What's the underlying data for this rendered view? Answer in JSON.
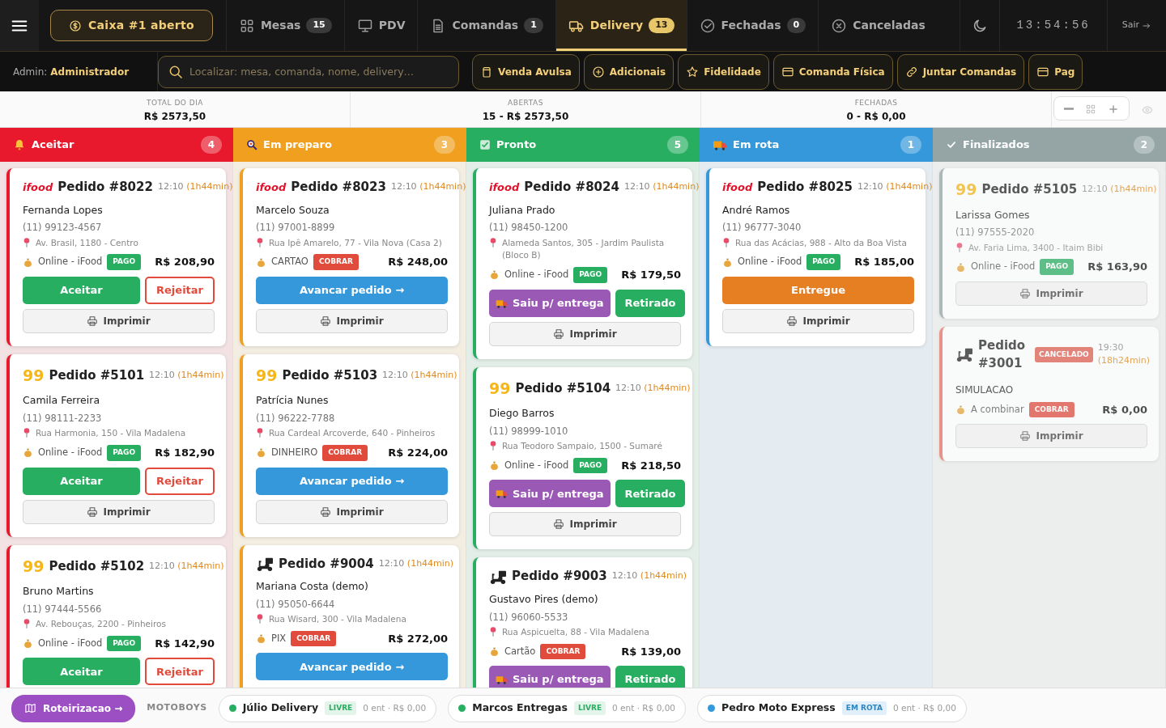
{
  "topbar": {
    "cash_button": "Caixa #1 aberto",
    "tabs": [
      {
        "label": "Mesas",
        "count": "15",
        "kind": "tables",
        "selected": false
      },
      {
        "label": "PDV",
        "kind": "pos",
        "selected": false
      },
      {
        "label": "Comandas",
        "count": "1",
        "kind": "orders",
        "selected": false
      },
      {
        "label": "Delivery",
        "count": "13",
        "kind": "delivery",
        "selected": true
      },
      {
        "label": "Fechadas",
        "count": "0",
        "kind": "closed",
        "selected": false
      },
      {
        "label": "Canceladas",
        "kind": "cancelled",
        "selected": false
      }
    ],
    "clock": "13:54:56",
    "logout": "Sair"
  },
  "subbar": {
    "user_label": "Admin:",
    "user_name": "Administrador",
    "search": {
      "placeholder": "Localizar: mesa, comanda, nome, delivery…"
    },
    "actions": [
      {
        "label": "Venda Avulsa",
        "kind": "sale"
      },
      {
        "label": "Adicionais",
        "kind": "extras"
      },
      {
        "label": "Fidelidade",
        "kind": "loyalty"
      },
      {
        "label": "Comanda Física",
        "kind": "ticket"
      },
      {
        "label": "Juntar Comandas",
        "kind": "merge"
      },
      {
        "label": "Pag",
        "kind": "payment"
      }
    ]
  },
  "stats": [
    {
      "label": "TOTAL DO DIA",
      "value": "R$ 2573,50"
    },
    {
      "label": "ABERTAS",
      "value": "15 - R$ 2573,50"
    },
    {
      "label": "FECHADAS",
      "value": "0 - R$ 0,00"
    }
  ],
  "columns": [
    {
      "title": "Aceitar",
      "count": "4",
      "color": "#e8192c",
      "kind": "incoming",
      "dimmed": false,
      "cards": [
        {
          "source": {
            "kind": "ifood",
            "label": "ifood"
          },
          "title": "Pedido #8022",
          "time": "12:10",
          "elapsed": "(1h44min)",
          "customer": "Fernanda Lopes",
          "phone": "(11) 99123-4567",
          "address": "Av. Brasil, 1180 - Centro",
          "payment": "Online - iFood",
          "payment_tag": {
            "label": "PAGO",
            "kind": "paid"
          },
          "total": "R$ 208,90",
          "actions": [
            {
              "label": "Aceitar",
              "kind": "accept"
            },
            {
              "label": "Rejeitar",
              "kind": "reject"
            },
            {
              "label": "Imprimir",
              "kind": "print"
            }
          ]
        },
        {
          "source": {
            "kind": "ninetynine",
            "label": "99"
          },
          "title": "Pedido #5101",
          "time": "12:10",
          "elapsed": "(1h44min)",
          "customer": "Camila Ferreira",
          "phone": "(11) 98111-2233",
          "address": "Rua Harmonia, 150 - Vila Madalena",
          "payment": "Online - iFood",
          "payment_tag": {
            "label": "PAGO",
            "kind": "paid"
          },
          "total": "R$ 182,90",
          "actions": [
            {
              "label": "Aceitar",
              "kind": "accept"
            },
            {
              "label": "Rejeitar",
              "kind": "reject"
            },
            {
              "label": "Imprimir",
              "kind": "print"
            }
          ]
        },
        {
          "source": {
            "kind": "ninetynine",
            "label": "99"
          },
          "title": "Pedido #5102",
          "time": "12:10",
          "elapsed": "(1h44min)",
          "customer": "Bruno Martins",
          "phone": "(11) 97444-5566",
          "address": "Av. Rebouças, 2200 - Pinheiros",
          "payment": "Online - iFood",
          "payment_tag": {
            "label": "PAGO",
            "kind": "paid"
          },
          "total": "R$ 142,90",
          "actions": [
            {
              "label": "Aceitar",
              "kind": "accept"
            },
            {
              "label": "Rejeitar",
              "kind": "reject"
            }
          ]
        }
      ]
    },
    {
      "title": "Em preparo",
      "count": "3",
      "color": "#f0a01e",
      "kind": "preparing",
      "dimmed": false,
      "cards": [
        {
          "source": {
            "kind": "ifood",
            "label": "ifood"
          },
          "title": "Pedido #8023",
          "time": "12:10",
          "elapsed": "(1h44min)",
          "customer": "Marcelo Souza",
          "phone": "(11) 97001-8899",
          "address": "Rua Ipê Amarelo, 77 - Vila Nova (Casa 2)",
          "payment": "CARTAO",
          "payment_tag": {
            "label": "COBRAR",
            "kind": "due"
          },
          "total": "R$ 248,00",
          "actions": [
            {
              "label": "Avancar pedido →",
              "kind": "advance"
            },
            {
              "label": "Imprimir",
              "kind": "print"
            }
          ]
        },
        {
          "source": {
            "kind": "ninetynine",
            "label": "99"
          },
          "title": "Pedido #5103",
          "time": "12:10",
          "elapsed": "(1h44min)",
          "customer": "Patrícia Nunes",
          "phone": "(11) 96222-7788",
          "address": "Rua Cardeal Arcoverde, 640 - Pinheiros",
          "payment": "DINHEIRO",
          "payment_tag": {
            "label": "COBRAR",
            "kind": "due"
          },
          "total": "R$ 224,00",
          "actions": [
            {
              "label": "Avancar pedido →",
              "kind": "advance"
            },
            {
              "label": "Imprimir",
              "kind": "print"
            }
          ]
        },
        {
          "source": {
            "kind": "moto"
          },
          "title": "Pedido #9004",
          "time": "12:10",
          "elapsed": "(1h44min)",
          "customer": "Mariana Costa (demo)",
          "phone": "(11) 95050-6644",
          "address": "Rua Wisard, 300 - Vila Madalena",
          "payment": "PIX",
          "payment_tag": {
            "label": "COBRAR",
            "kind": "due"
          },
          "total": "R$ 272,00",
          "actions": [
            {
              "label": "Avancar pedido →",
              "kind": "advance"
            }
          ]
        }
      ]
    },
    {
      "title": "Pronto",
      "count": "5",
      "color": "#27ae60",
      "kind": "ready",
      "dimmed": false,
      "cards": [
        {
          "source": {
            "kind": "ifood",
            "label": "ifood"
          },
          "title": "Pedido #8024",
          "time": "12:10",
          "elapsed": "(1h44min)",
          "customer": "Juliana Prado",
          "phone": "(11) 98450-1200",
          "address": "Alameda Santos, 305 - Jardim Paulista (Bloco B)",
          "payment": "Online - iFood",
          "payment_tag": {
            "label": "PAGO",
            "kind": "paid"
          },
          "total": "R$ 179,50",
          "actions": [
            {
              "label": "Saiu p/ entrega",
              "kind": "dispatch"
            },
            {
              "label": "Retirado",
              "kind": "pickup"
            },
            {
              "label": "Imprimir",
              "kind": "print"
            }
          ]
        },
        {
          "source": {
            "kind": "ninetynine",
            "label": "99"
          },
          "title": "Pedido #5104",
          "time": "12:10",
          "elapsed": "(1h44min)",
          "customer": "Diego Barros",
          "phone": "(11) 98999-1010",
          "address": "Rua Teodoro Sampaio, 1500 - Sumaré",
          "payment": "Online - iFood",
          "payment_tag": {
            "label": "PAGO",
            "kind": "paid"
          },
          "total": "R$ 218,50",
          "actions": [
            {
              "label": "Saiu p/ entrega",
              "kind": "dispatch"
            },
            {
              "label": "Retirado",
              "kind": "pickup"
            },
            {
              "label": "Imprimir",
              "kind": "print"
            }
          ]
        },
        {
          "source": {
            "kind": "moto"
          },
          "title": "Pedido #9003",
          "time": "12:10",
          "elapsed": "(1h44min)",
          "customer": "Gustavo Pires (demo)",
          "phone": "(11) 96060-5533",
          "address": "Rua Aspicuelta, 88 - Vila Madalena",
          "payment": "Cartão",
          "payment_tag": {
            "label": "COBRAR",
            "kind": "due"
          },
          "total": "R$ 139,00",
          "actions": [
            {
              "label": "Saiu p/ entrega",
              "kind": "dispatch"
            },
            {
              "label": "Retirado",
              "kind": "pickup"
            }
          ]
        }
      ]
    },
    {
      "title": "Em rota",
      "count": "1",
      "color": "#3498db",
      "kind": "route",
      "dimmed": false,
      "cards": [
        {
          "source": {
            "kind": "ifood",
            "label": "ifood"
          },
          "title": "Pedido #8025",
          "time": "12:10",
          "elapsed": "(1h44min)",
          "customer": "André Ramos",
          "phone": "(11) 96777-3040",
          "address": "Rua das Acácias, 988 - Alto da Boa Vista",
          "payment": "Online - iFood",
          "payment_tag": {
            "label": "PAGO",
            "kind": "paid"
          },
          "total": "R$ 185,00",
          "actions": [
            {
              "label": "Entregue",
              "kind": "deliver"
            },
            {
              "label": "Imprimir",
              "kind": "print"
            }
          ]
        }
      ]
    },
    {
      "title": "Finalizados",
      "count": "2",
      "color": "#95a5a6",
      "kind": "done",
      "dimmed": true,
      "cards": [
        {
          "source": {
            "kind": "ninetynine",
            "label": "99"
          },
          "title": "Pedido #5105",
          "time": "12:10",
          "elapsed": "(1h44min)",
          "customer": "Larissa Gomes",
          "phone": "(11) 97555-2020",
          "address": "Av. Faria Lima, 3400 - Itaim Bibi",
          "payment": "Online - iFood",
          "payment_tag": {
            "label": "PAGO",
            "kind": "paid"
          },
          "total": "R$ 163,90",
          "actions": [
            {
              "label": "Imprimir",
              "kind": "print"
            }
          ]
        },
        {
          "source": {
            "kind": "moto"
          },
          "title": "Pedido #3001",
          "status_tag": "CANCELADO",
          "time": "19:30",
          "elapsed": "(18h24min)",
          "customer": "SIMULACAO",
          "payment": "A combinar",
          "payment_tag": {
            "label": "COBRAR",
            "kind": "due"
          },
          "total": "R$ 0,00",
          "actions": [
            {
              "label": "Imprimir",
              "kind": "print"
            }
          ]
        }
      ]
    }
  ],
  "footer": {
    "route_button": "Roteirizacao →",
    "couriers_label": "MOTOBOYS",
    "couriers": [
      {
        "name": "Júlio Delivery",
        "status": "LIVRE",
        "kind": "free",
        "color": "#27ae60",
        "summary": "0 ent · R$ 0,00"
      },
      {
        "name": "Marcos Entregas",
        "status": "LIVRE",
        "kind": "free",
        "color": "#27ae60",
        "summary": "0 ent · R$ 0,00"
      },
      {
        "name": "Pedro Moto Express",
        "status": "EM ROTA",
        "kind": "route",
        "color": "#3498db",
        "summary": "0 ent · R$ 0,00"
      }
    ]
  }
}
